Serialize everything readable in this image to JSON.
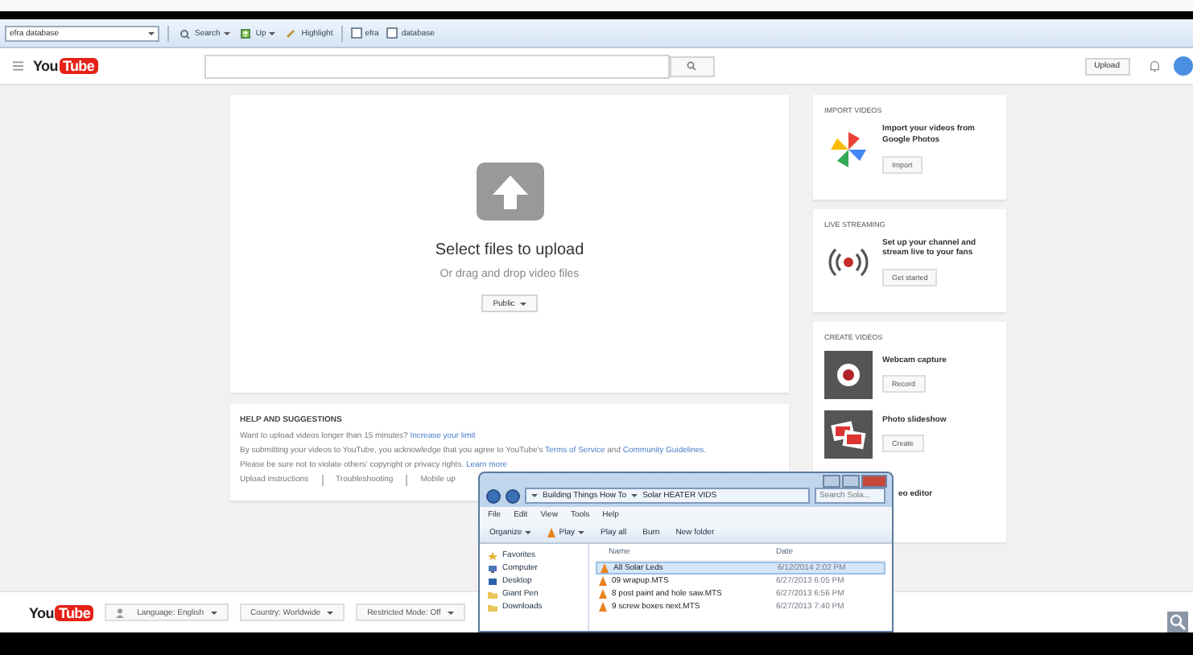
{
  "browser_toolbar": {
    "search_field": {
      "value": "efra database"
    },
    "buttons": [
      {
        "label": "Search",
        "kind": "search"
      },
      {
        "label": "Up",
        "kind": "up"
      },
      {
        "label": "Highlight",
        "kind": "highlight"
      }
    ],
    "terms": [
      {
        "label": "efra",
        "checked": false
      },
      {
        "label": "database",
        "checked": false
      }
    ]
  },
  "header": {
    "logo": {
      "first": "You",
      "second": "Tube"
    },
    "upload_button": "Upload"
  },
  "upload_card": {
    "title": "Select files to upload",
    "subtitle": "Or drag and drop video files",
    "privacy_button": "Public"
  },
  "help": {
    "title": "HELP AND SUGGESTIONS",
    "paragraphs": [
      [
        {
          "text": "Want to upload videos longer than 15 minutes? ",
          "kind": "text"
        },
        {
          "text": "Increase your limit",
          "kind": "link"
        }
      ],
      [
        {
          "text": "By submitting your videos to YouTube, you acknowledge that you agree to YouTube's ",
          "kind": "text"
        },
        {
          "text": "Terms of Service",
          "kind": "link"
        },
        {
          "text": " and ",
          "kind": "text"
        },
        {
          "text": "Community Guidelines",
          "kind": "link"
        },
        {
          "text": ".",
          "kind": "text"
        }
      ],
      [
        {
          "text": "Please be sure not to violate others' copyright or privacy rights. ",
          "kind": "text"
        },
        {
          "text": "Learn more",
          "kind": "link"
        }
      ]
    ],
    "links": [
      "Upload instructions",
      "Troubleshooting",
      "Mobile up"
    ]
  },
  "side_cards": [
    {
      "title": "IMPORT VIDEOS",
      "items": [
        {
          "kind": "pinwheel",
          "text": "Import your videos from Google Photos",
          "button": "Import"
        }
      ]
    },
    {
      "title": "LIVE STREAMING",
      "items": [
        {
          "kind": "live",
          "text": "Set up your channel and stream live to your fans",
          "button": "Get started"
        }
      ]
    },
    {
      "title": "CREATE VIDEOS",
      "items": [
        {
          "kind": "webcam",
          "text": "Webcam capture",
          "button": "Record"
        },
        {
          "kind": "slideshow",
          "text": "Photo slideshow",
          "button": "Create"
        },
        {
          "kind": "covered",
          "text": "eo editor"
        }
      ]
    }
  ],
  "footer": {
    "logo": {
      "first": "You",
      "second": "Tube"
    },
    "dropdowns": [
      {
        "label": "Language: English",
        "kind": "language"
      },
      {
        "label": "Country: Worldwide",
        "kind": "plain"
      },
      {
        "label": "Restricted Mode: Off",
        "kind": "plain"
      }
    ]
  },
  "explorer": {
    "path": [
      "Building Things How To",
      "Solar HEATER VIDS"
    ],
    "search": {
      "placeholder": "Search Sola..."
    },
    "menu": [
      "File",
      "Edit",
      "View",
      "Tools",
      "Help"
    ],
    "toolbar": [
      {
        "label": "Organize",
        "dropdown": true,
        "kind": "plain"
      },
      {
        "label": "Play",
        "dropdown": true,
        "kind": "play"
      },
      {
        "label": "Play all",
        "dropdown": false,
        "kind": "plain"
      },
      {
        "label": "Burn",
        "dropdown": false,
        "kind": "plain"
      },
      {
        "label": "New folder",
        "dropdown": false,
        "kind": "plain"
      }
    ],
    "nav": [
      {
        "label": "Favorites",
        "kind": "star"
      },
      {
        "label": "Computer",
        "kind": "computer"
      },
      {
        "label": "Desktop",
        "kind": "desktop"
      },
      {
        "label": "Giant Pen",
        "kind": "folder"
      },
      {
        "label": "Downloads",
        "kind": "folder"
      }
    ],
    "columns": [
      "Name",
      "Date"
    ],
    "files": [
      {
        "name": "All Solar Leds",
        "date": "6/12/2014 2:02 PM",
        "selected": true
      },
      {
        "name": "09 wrapup.MTS",
        "date": "6/27/2013 6:05 PM",
        "selected": false
      },
      {
        "name": "8 post paint and hole saw.MTS",
        "date": "6/27/2013 6:56 PM",
        "selected": false
      },
      {
        "name": "9 screw boxes next.MTS",
        "date": "6/27/2013 7:40 PM",
        "selected": false
      }
    ]
  }
}
